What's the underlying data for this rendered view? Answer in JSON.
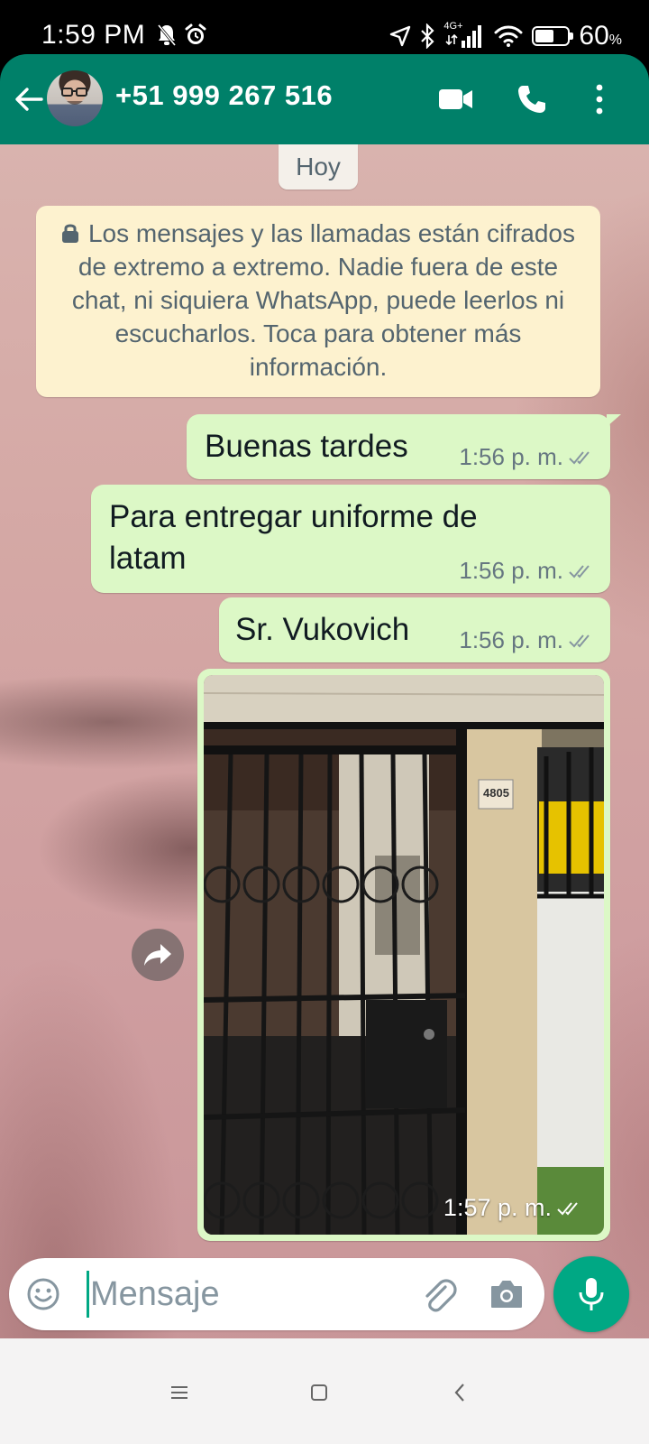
{
  "status_bar": {
    "time": "1:59 PM",
    "network": "4G+",
    "battery_percent": "60",
    "battery_symbol": "%",
    "battery_level": 0.6
  },
  "header": {
    "contact_name": "+51 999 267 516",
    "icons": [
      "back-arrow-icon",
      "avatar",
      "video-call-icon",
      "voice-call-icon",
      "more-options-icon"
    ]
  },
  "chat": {
    "date_label": "Hoy",
    "encryption_notice": "Los mensajes y las llamadas están cifrados de extremo a extremo. Nadie fuera de este chat, ni siquiera WhatsApp, puede leerlos ni escucharlos. Toca para obtener más información.",
    "messages": [
      {
        "text": "Buenas tardes",
        "time": "1:56 p. m."
      },
      {
        "text": "Para entregar uniforme de latam",
        "time": "1:56 p. m."
      },
      {
        "text": "Sr. Vukovich",
        "time": "1:56 p. m."
      }
    ],
    "image_message": {
      "time": "1:57 p. m.",
      "address_plate": "4805"
    }
  },
  "composer": {
    "placeholder": "Mensaje"
  },
  "colors": {
    "header": "#008069",
    "outgoing_bubble": "#dcf8c6",
    "notice": "#fdf2cf",
    "accent": "#00a884"
  }
}
